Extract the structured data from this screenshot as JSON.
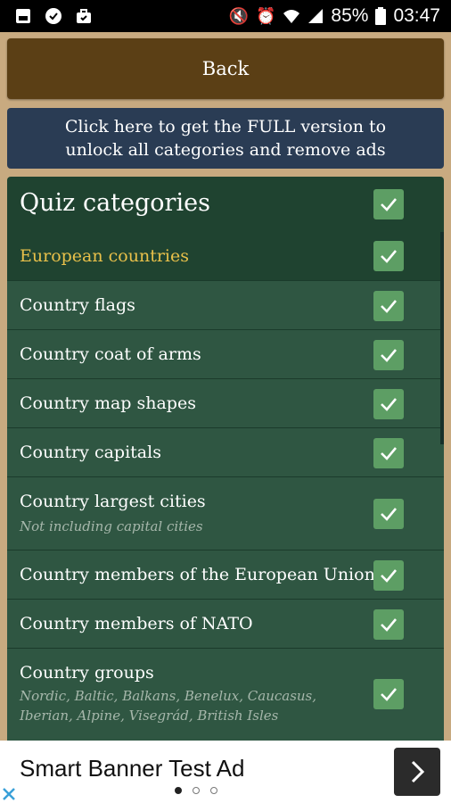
{
  "status_bar": {
    "battery": "85%",
    "time": "03:47",
    "icons_left": [
      "gallery-icon",
      "chat-icon",
      "briefcase-icon"
    ],
    "icons_right": [
      "mute-icon",
      "alarm-icon",
      "wifi-icon",
      "signal-icon",
      "battery-icon"
    ]
  },
  "back_button": {
    "label": "Back"
  },
  "full_version": {
    "line1": "Click here to get the FULL version to",
    "line2": "unlock all categories and remove ads"
  },
  "categories": {
    "title": "Quiz categories",
    "items": [
      {
        "label": "European countries",
        "selected": true,
        "checked": true
      },
      {
        "label": "Country flags",
        "checked": true
      },
      {
        "label": "Country coat of arms",
        "checked": true
      },
      {
        "label": "Country map shapes",
        "checked": true
      },
      {
        "label": "Country capitals",
        "checked": true
      },
      {
        "label": "Country largest cities",
        "sub": "Not including capital cities",
        "checked": true
      },
      {
        "label": "Country members of the European Union",
        "checked": true
      },
      {
        "label": "Country members of NATO",
        "checked": true
      },
      {
        "label": "Country groups",
        "sub1": "Nordic, Baltic, Balkans, Benelux, Caucasus,",
        "sub2": "Iberian, Alpine, Visegrád, British Isles",
        "checked": true
      }
    ]
  },
  "ad": {
    "title": "Smart Banner Test Ad",
    "page_dots": 3,
    "active_dot": 1
  },
  "colors": {
    "accent_yellow": "#e8c04a",
    "checkbox_green": "#5d9e64",
    "back_brown": "#5b3f15",
    "full_blue": "#2a3c54"
  }
}
